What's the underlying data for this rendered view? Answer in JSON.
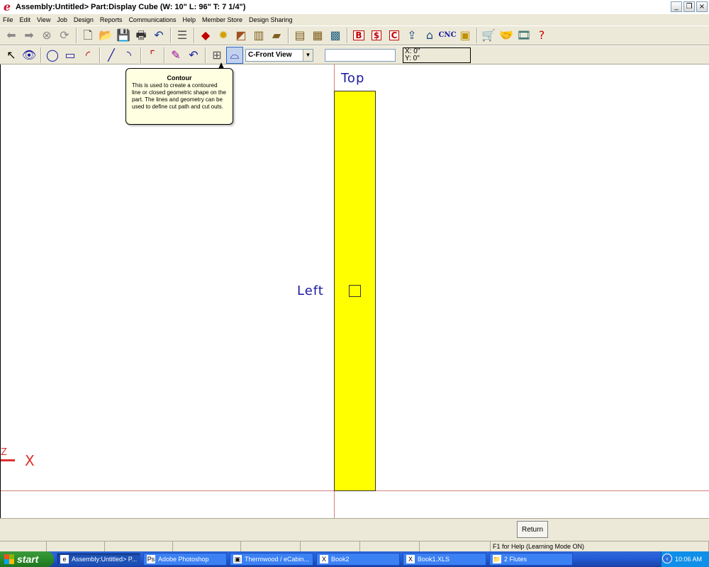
{
  "window": {
    "title": "Assembly:Untitled> Part:Display Cube (W: 10\" L: 96\" T: 7 1/4\")",
    "app_icon": "e",
    "minimize": "_",
    "restore": "❐",
    "close": "×"
  },
  "menu": [
    "File",
    "Edit",
    "View",
    "Job",
    "Design",
    "Reports",
    "Communications",
    "Help",
    "Member Store",
    "Design Sharing"
  ],
  "toolbar1": {
    "buttons": [
      {
        "name": "back-arrow-icon",
        "glyph": "⬅",
        "color": "#8a8a8a"
      },
      {
        "name": "forward-arrow-icon",
        "glyph": "➡",
        "color": "#8a8a8a"
      },
      {
        "name": "stop-icon",
        "glyph": "⊗",
        "color": "#8a8a8a"
      },
      {
        "name": "refresh-icon",
        "glyph": "⟳",
        "color": "#8a8a8a"
      },
      {
        "sep": true
      },
      {
        "name": "new-file-icon",
        "glyph": "🗋",
        "color": "#333333"
      },
      {
        "name": "open-folder-icon",
        "glyph": "📂",
        "color": "#c8a000"
      },
      {
        "name": "save-icon",
        "glyph": "💾",
        "color": "#333333"
      },
      {
        "name": "print-icon",
        "glyph": "🖶",
        "color": "#333333"
      },
      {
        "name": "undo-icon",
        "glyph": "↶",
        "color": "#1a3a9a"
      },
      {
        "sep": true
      },
      {
        "name": "properties-icon",
        "glyph": "☰",
        "color": "#555555"
      },
      {
        "sep": true
      },
      {
        "name": "material-icon",
        "glyph": "◆",
        "color": "#c00000"
      },
      {
        "name": "settings-sun-icon",
        "glyph": "✹",
        "color": "#d0a000"
      },
      {
        "name": "edge-profile-icon",
        "glyph": "◩",
        "color": "#a05020"
      },
      {
        "name": "doors-icon",
        "glyph": "▥",
        "color": "#806020"
      },
      {
        "name": "board-icon",
        "glyph": "▰",
        "color": "#806020"
      },
      {
        "sep": true
      },
      {
        "name": "cabinet-icon",
        "glyph": "▤",
        "color": "#806020"
      },
      {
        "name": "cabinet-library-icon",
        "glyph": "▦",
        "color": "#806020"
      },
      {
        "name": "catalog-icon",
        "glyph": "▩",
        "color": "#206080"
      },
      {
        "sep": true
      },
      {
        "name": "bid-report-icon",
        "glyph": "B",
        "color": "#c00000"
      },
      {
        "name": "price-report-icon",
        "glyph": "$",
        "color": "#c00000"
      },
      {
        "name": "cutlist-report-icon",
        "glyph": "C",
        "color": "#c00000"
      },
      {
        "name": "upload-icon",
        "glyph": "⇪",
        "color": "#205080"
      },
      {
        "name": "house-icon",
        "glyph": "⌂",
        "color": "#205080"
      },
      {
        "name": "cnc-icon",
        "glyph": "CNC",
        "color": "#1a1aa0"
      },
      {
        "name": "layout-icon",
        "glyph": "▣",
        "color": "#c09000"
      },
      {
        "sep": true
      },
      {
        "name": "cart-icon",
        "glyph": "🛒",
        "color": "#1a1aa0"
      },
      {
        "name": "handshake-icon",
        "glyph": "🤝",
        "color": "#806020"
      },
      {
        "name": "film-icon",
        "glyph": "🎞",
        "color": "#206060"
      },
      {
        "name": "help-icon",
        "glyph": "?",
        "color": "#d00000"
      }
    ]
  },
  "toolbar2": {
    "buttons": [
      {
        "name": "pointer-icon",
        "glyph": "↖",
        "color": "#000000"
      },
      {
        "name": "eye-icon",
        "glyph": "👁",
        "color": "#1a1aa0"
      },
      {
        "sep": true
      },
      {
        "name": "circle-tool-icon",
        "glyph": "◯",
        "color": "#1a1aa0"
      },
      {
        "name": "rectangle-tool-icon",
        "glyph": "▭",
        "color": "#1a1aa0"
      },
      {
        "name": "arc-tool-icon",
        "glyph": "◜",
        "color": "#c00000"
      },
      {
        "sep": true
      },
      {
        "name": "line-tool-icon",
        "glyph": "╱",
        "color": "#1a1aa0"
      },
      {
        "name": "curve-tool-icon",
        "glyph": "◝",
        "color": "#1a1aa0"
      },
      {
        "sep": true
      },
      {
        "name": "corner-tool-icon",
        "glyph": "⌜",
        "color": "#c00000"
      },
      {
        "sep": true
      },
      {
        "name": "eraser-icon",
        "glyph": "✎",
        "color": "#a000a0"
      },
      {
        "name": "undo-drawing-icon",
        "glyph": "↶",
        "color": "#1a1aa0"
      },
      {
        "sep": true
      },
      {
        "name": "grid-icon",
        "glyph": "⊞",
        "color": "#555555"
      },
      {
        "name": "contour-tool-icon",
        "glyph": "⌓",
        "color": "#1a1aa0",
        "active": true
      }
    ],
    "view_select": "C-Front View",
    "input_value": "",
    "coord_x": "X: 0\"",
    "coord_y": "Y: 0\""
  },
  "tooltip": {
    "title": "Contour",
    "body": "This is used to create a contoured line or closed geometric shape on the part. The lines and geometry can be used to define cut path and cut outs."
  },
  "canvas": {
    "label_top": "Top",
    "label_left": "Left",
    "label_x": "X",
    "label_z": "Z",
    "part_color": "#ffff00"
  },
  "bottom": {
    "return_label": "Return"
  },
  "statusbar": {
    "help_text": "F1 for Help (Learning Mode ON)"
  },
  "taskbar": {
    "start_label": "start",
    "tasks": [
      {
        "label": "Assembly:Untitled> P...",
        "icon": "e",
        "active": true
      },
      {
        "label": "Adobe Photoshop",
        "icon": "Ps",
        "active": false
      },
      {
        "label": "Thermwood / eCabin...",
        "icon": "▣",
        "active": false
      },
      {
        "label": "Book2",
        "icon": "X",
        "active": false
      },
      {
        "label": "Book1.XLS",
        "icon": "X",
        "active": false
      },
      {
        "label": "2 Flutes",
        "icon": "📁",
        "active": false
      }
    ],
    "clock": "10:06 AM"
  }
}
